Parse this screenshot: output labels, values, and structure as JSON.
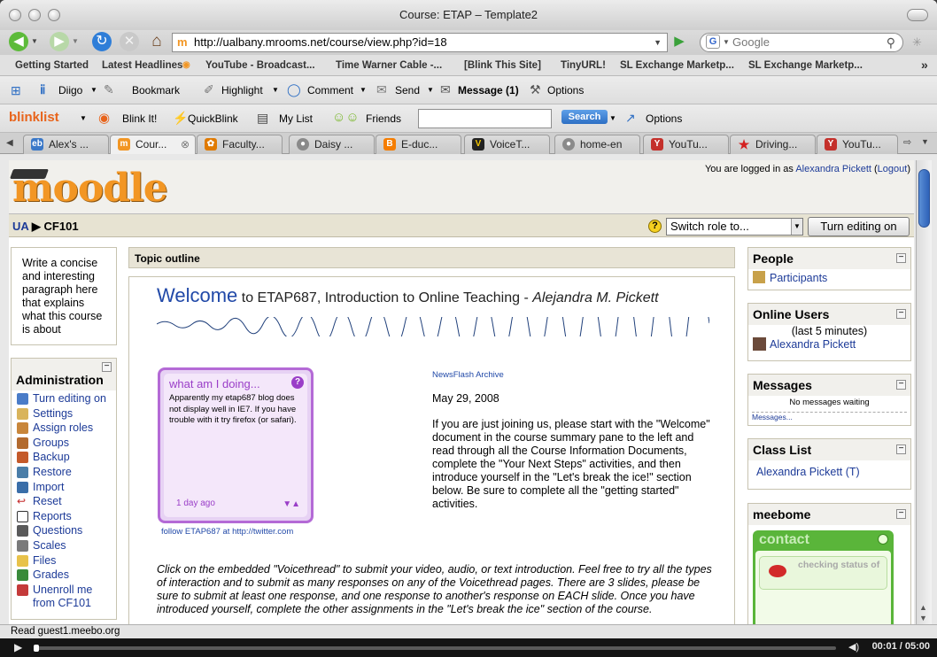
{
  "window": {
    "title": "Course: ETAP – Template2"
  },
  "nav": {
    "url": "http://ualbany.mrooms.net/course/view.php?id=18",
    "search_engine_letter": "G",
    "search_placeholder": "Google"
  },
  "bookmarks": [
    "Getting Started",
    "Latest Headlines",
    "YouTube - Broadcast...",
    "Time Warner Cable -...",
    "[Blink This Site]",
    "TinyURL!",
    "SL Exchange Marketp...",
    "SL Exchange Marketp..."
  ],
  "diigo": {
    "brand": "Diigo",
    "bookmark": "Bookmark",
    "highlight": "Highlight",
    "comment": "Comment",
    "send": "Send",
    "message": "Message (1)",
    "options": "Options"
  },
  "blinklist": {
    "brand": "blinklist",
    "blinkit": "Blink It!",
    "quickblink": "QuickBlink",
    "mylist": "My List",
    "friends": "Friends",
    "search_button": "Search",
    "options": "Options"
  },
  "tabs": [
    {
      "label": "Alex's ...",
      "icon": "eb",
      "color": "#3a78c8"
    },
    {
      "label": "Cour...",
      "icon": "m",
      "color": "#f29624"
    },
    {
      "label": "Faculty...",
      "icon": "✿",
      "color": "#e07a00"
    },
    {
      "label": "Daisy ...",
      "icon": "●",
      "color": "#8a8a8a"
    },
    {
      "label": "E-duc...",
      "icon": "B",
      "color": "#f57d00"
    },
    {
      "label": "VoiceT...",
      "icon": "V",
      "color": "#222"
    },
    {
      "label": "home-en",
      "icon": "●",
      "color": "#8a8a8a"
    },
    {
      "label": "YouTu...",
      "icon": "Y",
      "color": "#c4302b"
    },
    {
      "label": "Driving...",
      "icon": "★",
      "color": "#d42020"
    },
    {
      "label": "YouTu...",
      "icon": "Y",
      "color": "#c4302b"
    }
  ],
  "moodle": {
    "logo": "moodle",
    "logged_in_prefix": "You are logged in as ",
    "user": "Alexandra Pickett",
    "logout": "Logout",
    "breadcrumb_home": "UA",
    "breadcrumb_course": "CF101",
    "role_select": "Switch role to...",
    "edit_button": "Turn editing on"
  },
  "summary_text": "Write a concise and interesting paragraph here that explains what this course is about",
  "admin": {
    "title": "Administration",
    "items": [
      "Turn editing on",
      "Settings",
      "Assign roles",
      "Groups",
      "Backup",
      "Restore",
      "Import",
      "Reset",
      "Reports",
      "Questions",
      "Scales",
      "Files",
      "Grades",
      "Unenroll me from CF101"
    ]
  },
  "topic": {
    "header": "Topic outline",
    "welcome_big": "Welcome",
    "welcome_rest": " to ETAP687, Introduction to Online Teaching - ",
    "welcome_author": "Alejandra M. Pickett",
    "twitter_title": "what am I doing...",
    "twitter_text": "Apparently my etap687 blog does not display well in IE7. If you have trouble with it try firefox (or safari).",
    "twitter_time": "1 day ago",
    "twitter_follow": "follow ETAP687 at http://twitter.com",
    "news_archive": "NewsFlash Archive",
    "news_date": "May 29, 2008",
    "news_text": "If you are just joining us, please start with the \"Welcome\" document in the course summary pane to the left and read through all the Course Information Documents, complete the \"Your Next Steps\" activities, and then introduce yourself in the \"Let's break the ice!\" section below. Be sure to complete all the \"getting started\" activities.",
    "instructions": "Click on the embedded \"Voicethread\" to submit your video, audio, or text introduction. Feel free to try all the types of interaction and to submit as many responses on any of the Voicethread pages. There are 3 slides, please be sure to submit at least one response, and one response to another's response on EACH slide. Once you have introduced yourself, complete the other assignments in the \"Let's break the ice\" section of the course."
  },
  "right": {
    "people_title": "People",
    "participants": "Participants",
    "online_title": "Online Users",
    "online_sub": "(last 5 minutes)",
    "online_user": "Alexandra Pickett",
    "messages_title": "Messages",
    "messages_none": "No messages waiting",
    "messages_link": "Messages...",
    "classlist_title": "Class List",
    "classlist_user": "Alexandra Pickett (T)",
    "meebome_title": "meebome",
    "contact": "contact",
    "checking": "checking status of"
  },
  "status": {
    "text": "Read guest1.meebo.org"
  },
  "player": {
    "time": "00:01 / 05:00"
  }
}
